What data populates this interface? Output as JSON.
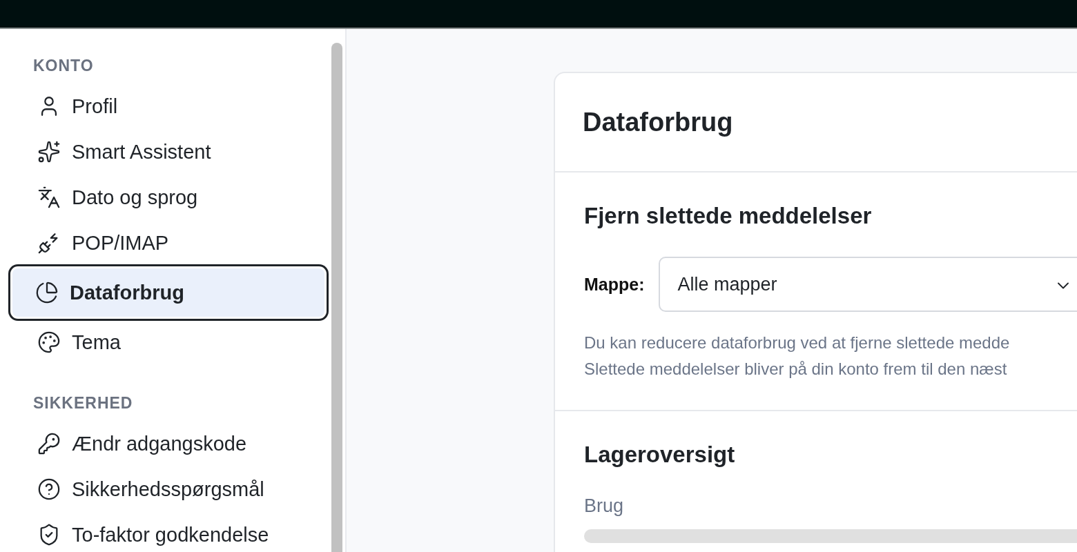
{
  "sidebar": {
    "sections": [
      {
        "title": "KONTO",
        "items": [
          {
            "label": "Profil",
            "selected": false
          },
          {
            "label": "Smart Assistent",
            "selected": false
          },
          {
            "label": "Dato og sprog",
            "selected": false
          },
          {
            "label": "POP/IMAP",
            "selected": false
          },
          {
            "label": "Dataforbrug",
            "selected": true
          },
          {
            "label": "Tema",
            "selected": false
          }
        ]
      },
      {
        "title": "SIKKERHED",
        "items": [
          {
            "label": "Ændr adgangskode",
            "selected": false
          },
          {
            "label": "Sikkerhedsspørgsmål",
            "selected": false
          },
          {
            "label": "To-faktor godkendelse",
            "selected": false
          }
        ]
      }
    ]
  },
  "content": {
    "title": "Dataforbrug",
    "sections": [
      {
        "kind": "form",
        "title": "Fjern slettede meddelelser",
        "field": {
          "label": "Mappe:",
          "value": "Alle mapper"
        },
        "description": "Du kan reducere dataforbrug ved at fjerne slettede medde\nSlettede meddelelser bliver på din konto frem til den næst"
      },
      {
        "kind": "usage",
        "title": "Lageroversigt",
        "label": "Brug"
      }
    ]
  }
}
